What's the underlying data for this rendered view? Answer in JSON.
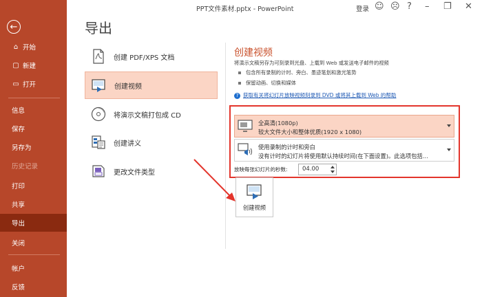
{
  "app": {
    "doc_title": "PPT文件素材.pptx  -  PowerPoint",
    "login": "登录",
    "icons": [
      "smiley-icon",
      "frown-icon",
      "help-icon"
    ]
  },
  "sidebar": {
    "back_icon": "←",
    "items": [
      {
        "label": "开始",
        "icon": "⌂"
      },
      {
        "label": "新建",
        "icon": "▢"
      },
      {
        "label": "打开",
        "icon": "▭"
      },
      {
        "label": "信息"
      },
      {
        "label": "保存"
      },
      {
        "label": "另存为"
      },
      {
        "label": "历史记录"
      },
      {
        "label": "打印"
      },
      {
        "label": "共享"
      },
      {
        "label": "导出"
      },
      {
        "label": "关闭"
      },
      {
        "label": "帐户"
      },
      {
        "label": "反馈"
      }
    ],
    "active": "导出"
  },
  "page": {
    "title": "导出"
  },
  "export_options": [
    {
      "label": "创建 PDF/XPS 文档"
    },
    {
      "label": "创建视频"
    },
    {
      "label": "将演示文稿打包成 CD"
    },
    {
      "label": "创建讲义"
    },
    {
      "label": "更改文件类型"
    }
  ],
  "video": {
    "title": "创建视频",
    "description": "将演示文稿另存为可刻录到光盘、上载到 Web 或发送电子邮件的视频",
    "bullets": [
      "包含所有录制的计时、旁白、墨迹笔划和激光笔势",
      "保留动画、切换和媒体"
    ],
    "help_link": "获取有关将幻灯片放映视频刻录到 DVD 或将其上载到 Web 的帮助",
    "quality": {
      "title": "全高清(1080p)",
      "subtitle": "较大文件大小和整体优质(1920 x 1080)"
    },
    "timing": {
      "title": "使用录制的计时和旁白",
      "subtitle": "没有计时的幻灯片将使用默认持续时间(在下面设置)。此选项包括..."
    },
    "seconds_label": "放映每张幻灯片的秒数:",
    "seconds_value": "04.00",
    "create_button": "创建视频"
  }
}
